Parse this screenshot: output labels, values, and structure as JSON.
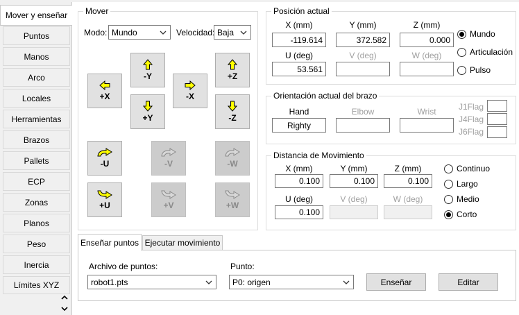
{
  "nav": {
    "items": [
      {
        "label": "Mover y enseñar",
        "active": true
      },
      {
        "label": "Puntos"
      },
      {
        "label": "Manos"
      },
      {
        "label": "Arco"
      },
      {
        "label": "Locales"
      },
      {
        "label": "Herramientas"
      },
      {
        "label": "Brazos"
      },
      {
        "label": "Pallets"
      },
      {
        "label": "ECP"
      },
      {
        "label": "Zonas"
      },
      {
        "label": "Planos"
      },
      {
        "label": "Peso"
      },
      {
        "label": "Inercia"
      },
      {
        "label": "Límites XYZ"
      }
    ]
  },
  "mover": {
    "title": "Mover",
    "mode_label": "Modo:",
    "mode_value": "Mundo",
    "speed_label": "Velocidad:",
    "speed_value": "Baja",
    "jog": {
      "minus_y": "-Y",
      "plus_y": "+Y",
      "plus_x": "+X",
      "minus_x": "-X",
      "plus_z": "+Z",
      "minus_z": "-Z",
      "minus_u": "-U",
      "minus_v": "-V",
      "minus_w": "-W",
      "plus_u": "+U",
      "plus_v": "+V",
      "plus_w": "+W"
    }
  },
  "position": {
    "title": "Posición actual",
    "x_label": "X (mm)",
    "y_label": "Y (mm)",
    "z_label": "Z (mm)",
    "x": "-119.614",
    "y": "372.582",
    "z": "0.000",
    "u_label": "U (deg)",
    "v_label": "V (deg)",
    "w_label": "W (deg)",
    "u": "53.561",
    "v": "",
    "w": "",
    "radios": [
      "Mundo",
      "Articulación",
      "Pulso"
    ],
    "selected": "Mundo"
  },
  "orientation": {
    "title": "Orientación actual del brazo",
    "hand_label": "Hand",
    "elbow_label": "Elbow",
    "wrist_label": "Wrist",
    "hand": "Righty",
    "j1": "J1Flag",
    "j4": "J4Flag",
    "j6": "J6Flag"
  },
  "distance": {
    "title": "Distancia de Movimiento",
    "x_label": "X (mm)",
    "y_label": "Y (mm)",
    "z_label": "Z (mm)",
    "x": "0.100",
    "y": "0.100",
    "z": "0.100",
    "u_label": "U (deg)",
    "v_label": "V (deg)",
    "w_label": "W (deg)",
    "u": "0.100",
    "radios": [
      "Continuo",
      "Largo",
      "Medio",
      "Corto"
    ],
    "selected": "Corto"
  },
  "tabs": [
    "Enseñar puntos",
    "Ejecutar movimiento"
  ],
  "teach": {
    "file_label": "Archivo de puntos:",
    "file_value": "robot1.pts",
    "point_label": "Punto:",
    "point_value": "P0: origen",
    "teach_button": "Enseñar",
    "edit_button": "Editar"
  }
}
